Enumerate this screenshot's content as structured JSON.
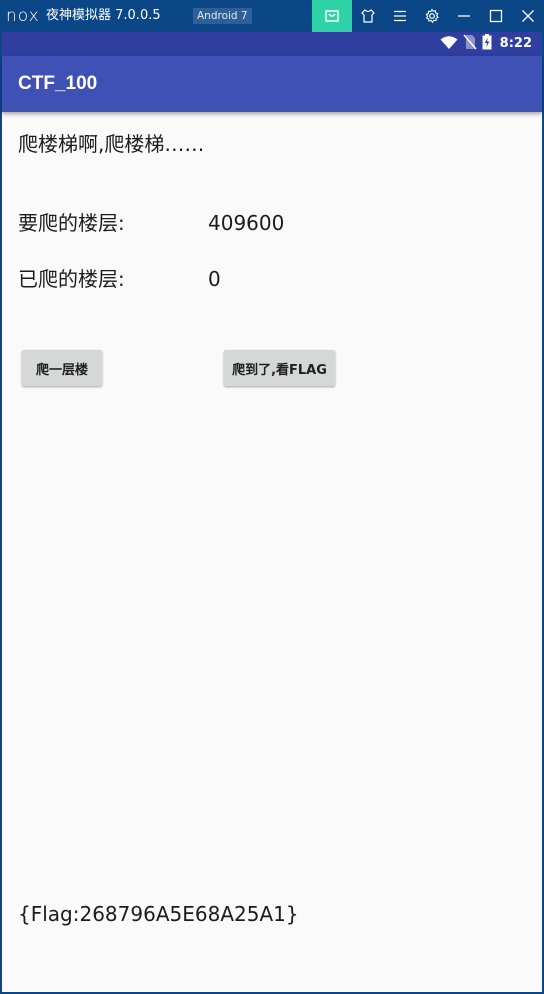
{
  "emulator": {
    "logo": "nox",
    "title": "夜神模拟器 7.0.0.5",
    "android_badge": "Android 7",
    "controls": [
      "store-icon",
      "shirt-icon",
      "menu-icon",
      "settings-icon",
      "minimize-icon",
      "maximize-icon",
      "close-icon"
    ],
    "colors": {
      "bar": "#0b4787",
      "store_accent": "#2dd3a7"
    }
  },
  "status_bar": {
    "time": "8:22",
    "icons": [
      "wifi-icon",
      "no-sim-icon",
      "battery-charging-icon"
    ],
    "color": "#303f9f"
  },
  "app_bar": {
    "title": "CTF_100",
    "color": "#3f51b5"
  },
  "main": {
    "heading": "爬楼梯啊,爬楼梯……",
    "target_label": "要爬的楼层:",
    "target_value": "409600",
    "climbed_label": "已爬的楼层:",
    "climbed_value": "0",
    "climb_button": "爬一层楼",
    "flag_button": "爬到了,看FLAG",
    "flag_text": "{Flag:268796A5E68A25A1}"
  }
}
